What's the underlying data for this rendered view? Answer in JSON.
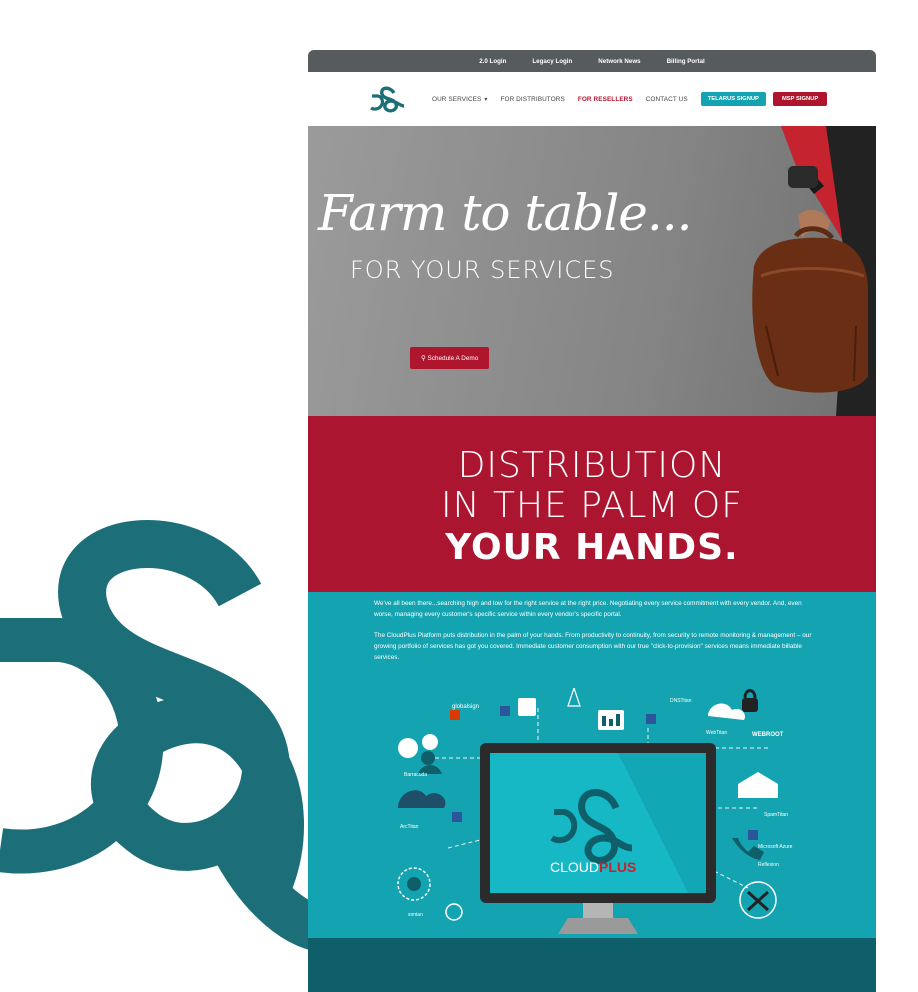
{
  "topbar": {
    "links": [
      "2.0 Login",
      "Legacy Login",
      "Network News",
      "Billing Portal"
    ]
  },
  "nav": {
    "items": [
      "OUR SERVICES",
      "FOR DISTRIBUTORS",
      "FOR RESELLERS",
      "CONTACT US"
    ],
    "caret": "▾",
    "telarus_signup": "TELARUS SIGNUP",
    "msp_signup": "MSP SIGNUP"
  },
  "hero": {
    "headline": "Farm to table...",
    "subheadline": "FOR YOUR SERVICES",
    "demo_icon": "⚲",
    "demo_button": "Schedule A Demo"
  },
  "distribution": {
    "line1": "DISTRIBUTION",
    "line2": "IN THE PALM OF",
    "line3": "YOUR HANDS."
  },
  "body": {
    "p1": "We've all been there...searching high and low for the right service at the right price. Negotiating every service commitment with every vendor. And, even worse, managing every customer's specific service within every vendor's specific portal.",
    "p2": "The CloudPlus Platform puts distribution in the palm of your hands. From productivity to continuity, from security to remote monitoring & management – our growing portfolio of services has got you covered. Immediate customer consumption with our true \"click-to-provision\" services means immediate billable services."
  },
  "illustration": {
    "monitor_brand_1": "CLOUD",
    "monitor_brand_2": "PLUS",
    "vendors": [
      "globalsign",
      "DNSTitan",
      "WebTitan",
      "WEBROOT",
      "Barracuda",
      "SpamTitan",
      "ArcTitan",
      "Microsoft Azure",
      "Reflexion",
      "sonian"
    ]
  },
  "colors": {
    "teal": "#14a3b1",
    "red": "#ab1530",
    "dark_teal": "#0f5f6b",
    "topbar": "#565b5e",
    "logo": "#1c6f78"
  }
}
